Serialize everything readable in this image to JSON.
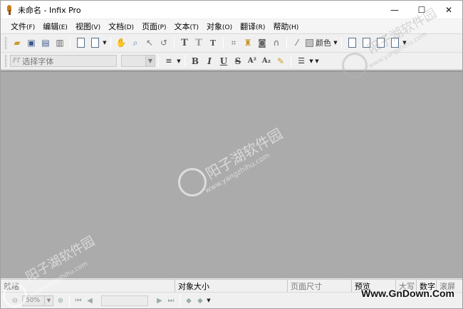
{
  "window": {
    "title": "未命名 - Infix Pro",
    "controls": {
      "minimize": "—",
      "maximize": "☐",
      "close": "✕"
    }
  },
  "menu": [
    {
      "label": "文件",
      "accel": "(F)"
    },
    {
      "label": "编辑",
      "accel": "(E)"
    },
    {
      "label": "视图",
      "accel": "(V)"
    },
    {
      "label": "文档",
      "accel": "(D)"
    },
    {
      "label": "页面",
      "accel": "(P)"
    },
    {
      "label": "文本",
      "accel": "(T)"
    },
    {
      "label": "对象",
      "accel": "(O)"
    },
    {
      "label": "翻译",
      "accel": "(R)"
    },
    {
      "label": "帮助",
      "accel": "(H)"
    }
  ],
  "toolbar1": {
    "color_label": "颜色",
    "icons": [
      "open-icon",
      "save-icon",
      "save-as-icon",
      "print-icon",
      "insert-page-icon",
      "page-options-icon",
      "hand-tool-icon",
      "zoom-tool-icon",
      "select-tool-icon",
      "rotate-tool-icon",
      "text-tool-icon",
      "text-outline-tool-icon",
      "text-hand-tool-icon",
      "crop-tool-icon",
      "stamp-tool-icon",
      "camera-tool-icon",
      "link-tool-icon",
      "eyedropper-icon"
    ],
    "glyphs": {
      "text": "T",
      "text_outline": "T",
      "text_hand": "T"
    }
  },
  "toolbar2": {
    "font_placeholder": "选择字体",
    "font_icon": "Ff",
    "format": {
      "bold": "B",
      "italic": "I",
      "underline": "U",
      "strike": "S",
      "superscript": "A²",
      "subscript": "A₂"
    }
  },
  "status": {
    "state": "就绪",
    "object_size": "对象大小",
    "page_size": "页面尺寸",
    "preview": "预览",
    "caps": "大写",
    "num": "数字",
    "scroll": "滚屏"
  },
  "nav": {
    "zoom": "50%"
  },
  "watermark": {
    "cn": "阳子湖软件园",
    "url": "www.yangzhihu.com",
    "brand": "Www.GnDown.Com"
  }
}
